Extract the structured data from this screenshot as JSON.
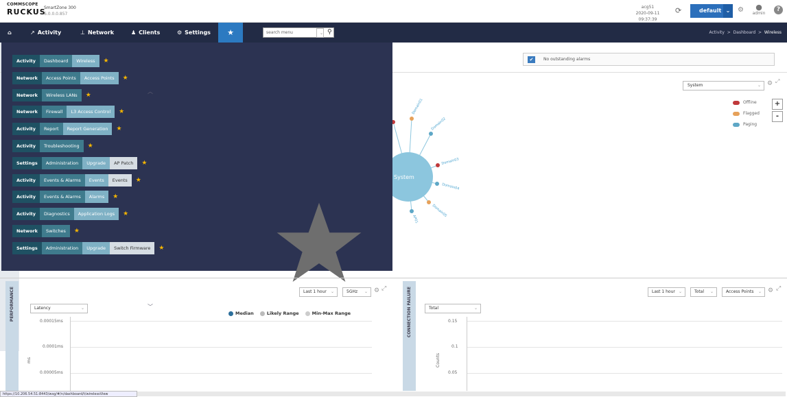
{
  "brand": {
    "company": "COMMSCOPE",
    "product_logo": "RUCKUS",
    "product_name": "SmartZone 300",
    "version": "6.0.0.0.857"
  },
  "header": {
    "account": "acg51",
    "datetime": "2020-09-11 09:37:39",
    "domain": "default",
    "user": "admin"
  },
  "nav": {
    "items": [
      "Activity",
      "Network",
      "Clients",
      "Settings"
    ],
    "search_placeholder": "search menu"
  },
  "breadcrumb": {
    "items": [
      "Activity",
      "Dashboard",
      "Wireless"
    ],
    "sep": ">"
  },
  "alarm": {
    "text": "No outstanding alarms"
  },
  "topology": {
    "scope": "System",
    "center": "System",
    "legend": [
      {
        "label": "Offline",
        "color": "#c0393b"
      },
      {
        "label": "Flagged",
        "color": "#e6a15a"
      },
      {
        "label": "Paging",
        "color": "#5ea7c6"
      }
    ],
    "zoom_in": "+",
    "zoom_out": "-",
    "nodes": [
      "Domain01",
      "Domain02",
      "Domain03",
      "Domain04",
      "Domain05",
      "AP01"
    ]
  },
  "favorites": [
    {
      "path": [
        "Activity",
        "Dashboard",
        "Wireless"
      ]
    },
    {
      "path": [
        "Network",
        "Access Points",
        "Access Points"
      ]
    },
    {
      "path": [
        "Network",
        "Wireless LANs"
      ]
    },
    {
      "path": [
        "Network",
        "Firewall",
        "L3 Access Control"
      ]
    },
    {
      "path": [
        "Activity",
        "Report",
        "Report Generation"
      ]
    },
    {
      "path": [
        "Activity",
        "Troubleshooting"
      ]
    },
    {
      "path": [
        "Settings",
        "Administration",
        "Upgrade",
        "AP Patch"
      ]
    },
    {
      "path": [
        "Activity",
        "Events & Alarms",
        "Events",
        "Events"
      ]
    },
    {
      "path": [
        "Activity",
        "Events & Alarms",
        "Alarms"
      ]
    },
    {
      "path": [
        "Activity",
        "Diagnostics",
        "Application Logs"
      ]
    },
    {
      "path": [
        "Network",
        "Switches"
      ]
    },
    {
      "path": [
        "Settings",
        "Administration",
        "Upgrade",
        "Switch Firmware"
      ]
    }
  ],
  "performance": {
    "tab": "PERFORMANCE",
    "time": "Last 1 hour",
    "band": "5GHz",
    "metric": "Latency",
    "legend": [
      "Median",
      "Likely Range",
      "Min-Max Range"
    ],
    "yaxis": "ms",
    "ticks": [
      "0.00015ms",
      "0.0001ms",
      "0.00005ms"
    ]
  },
  "connection": {
    "tab": "CONNECTION FAILURE",
    "time": "Last 1 hour",
    "total": "Total",
    "scope": "Access Points",
    "metric": "Total",
    "yaxis": "Counts",
    "ticks": [
      "0.15",
      "0.1",
      "0.05"
    ]
  },
  "statusbar": "https://10.206.54.51:8443/wsg/#/n/dashboard/t/wirelessView"
}
